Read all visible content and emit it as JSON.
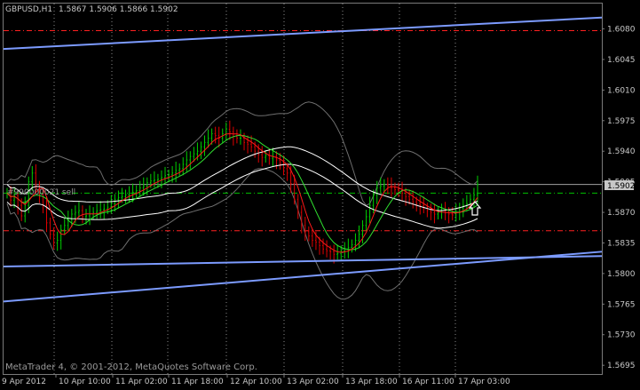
{
  "header": {
    "symbol": "GBPUSD,H1",
    "ohlc": "1.5867 1.5906 1.5866 1.5902"
  },
  "footer": {
    "copyright": "MetaTrader 4, © 2001-2012, MetaQuotes Software Corp."
  },
  "object_label": "#990000021 sell",
  "chart_data": {
    "type": "line",
    "title": "GBPUSD,H1",
    "ylim": [
      1.5685,
      1.6109
    ],
    "y_ticks": [
      "1.6080",
      "1.6045",
      "1.6010",
      "1.5975",
      "1.5940",
      "1.5905",
      "1.5870",
      "1.5835",
      "1.5800",
      "1.5765",
      "1.5730",
      "1.5695"
    ],
    "x_ticks": [
      "9 Apr 2012",
      "10 Apr 10:00",
      "11 Apr 02:00",
      "11 Apr 18:00",
      "12 Apr 10:00",
      "13 Apr 02:00",
      "13 Apr 18:00",
      "16 Apr 11:00",
      "17 Apr 03:00"
    ],
    "current_price": "1.5902",
    "horizontal_levels": {
      "upper_red": 1.6078,
      "lower_red": 1.5849,
      "green": 1.5892,
      "white_price_line": 1.5902
    },
    "trend_lines": [
      {
        "name": "upper-channel",
        "from": {
          "bar": 0,
          "price": 1.6057
        },
        "to": {
          "bar": 200,
          "price": 1.6093
        }
      },
      {
        "name": "lower-channel",
        "from": {
          "bar": 0,
          "price": 1.5768
        },
        "to": {
          "bar": 200,
          "price": 1.5825
        }
      },
      {
        "name": "support-line",
        "from": {
          "bar": 0,
          "price": 1.5808
        },
        "to": {
          "bar": 200,
          "price": 1.582
        }
      }
    ],
    "bars_count": 132,
    "close_series": [
      1.5892,
      1.5884,
      1.5889,
      1.5878,
      1.5866,
      1.5878,
      1.5905,
      1.5915,
      1.59,
      1.5888,
      1.5878,
      1.5858,
      1.5845,
      1.5835,
      1.5838,
      1.585,
      1.5855,
      1.5862,
      1.5868,
      1.587,
      1.5872,
      1.5865,
      1.5866,
      1.5868,
      1.587,
      1.5872,
      1.5873,
      1.5874,
      1.5876,
      1.588,
      1.5885,
      1.5887,
      1.5888,
      1.589,
      1.5892,
      1.5893,
      1.5895,
      1.5898,
      1.59,
      1.5904,
      1.5906,
      1.5907,
      1.5908,
      1.591,
      1.5912,
      1.5913,
      1.5915,
      1.5918,
      1.592,
      1.5925,
      1.593,
      1.5934,
      1.5937,
      1.594,
      1.5945,
      1.595,
      1.5955,
      1.596,
      1.5958,
      1.5955,
      1.596,
      1.5965,
      1.5962,
      1.5957,
      1.5955,
      1.5955,
      1.595,
      1.5948,
      1.5945,
      1.594,
      1.5936,
      1.5933,
      1.5935,
      1.5932,
      1.5934,
      1.593,
      1.5925,
      1.592,
      1.5915,
      1.5903,
      1.5885,
      1.587,
      1.5855,
      1.5848,
      1.5843,
      1.5838,
      1.5836,
      1.5832,
      1.5828,
      1.5826,
      1.5825,
      1.5822,
      1.5823,
      1.5826,
      1.5828,
      1.583,
      1.5833,
      1.5838,
      1.5845,
      1.5855,
      1.5865,
      1.5878,
      1.589,
      1.5898,
      1.59,
      1.5902,
      1.59,
      1.5898,
      1.5896,
      1.5895,
      1.5892,
      1.5888,
      1.5885,
      1.5882,
      1.588,
      1.5878,
      1.5875,
      1.5872,
      1.587,
      1.5868,
      1.587,
      1.5872,
      1.587,
      1.5868,
      1.5867,
      1.587,
      1.5875,
      1.5878,
      1.588,
      1.5885,
      1.589,
      1.5902
    ],
    "grid": true,
    "colors": {
      "background": "#000000",
      "bull_candle": "#00d000",
      "bear_candle": "#e00000",
      "grid": "#8a8a8a",
      "trend": "#7c9bff",
      "level_red": "#ff2020",
      "level_green": "#00c000",
      "ma_fast": "#ff1a1a",
      "ma_slow": "#30e030",
      "envelope": "#ffffff",
      "bands": "#6e6e6e"
    }
  }
}
